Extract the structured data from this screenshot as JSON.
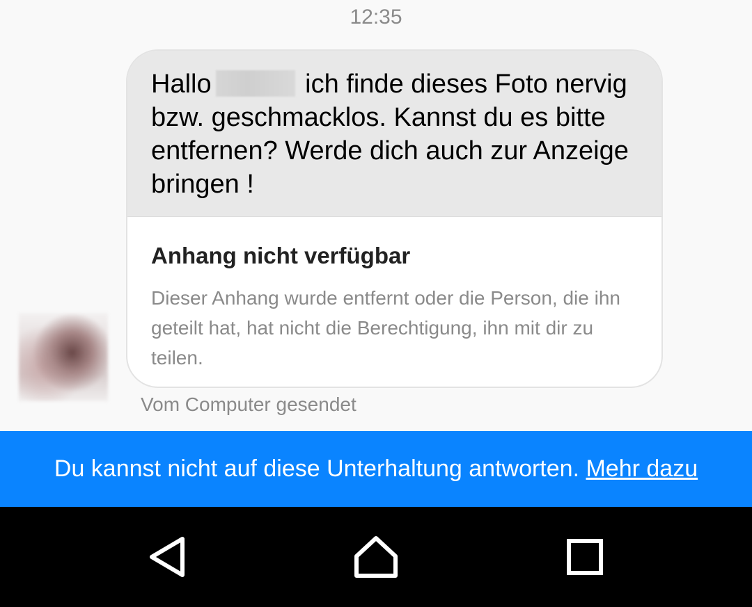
{
  "conversation": {
    "timestamp": "12:35",
    "message": {
      "greeting": "Hallo",
      "text_after_name": " ich finde dieses Foto nervig bzw. geschmacklos. Kannst du es bitte entfernen? Werde dich auch zur Anzeige bringen !"
    },
    "attachment": {
      "title": "Anhang nicht verfügbar",
      "description": "Dieser Anhang wurde entfernt oder die Person, die ihn geteilt hat, hat nicht die Berechtigung, ihn mit dir zu teilen."
    },
    "sent_via": "Vom Computer gesendet"
  },
  "banner": {
    "text": "Du kannst nicht auf diese Unterhaltung antworten. ",
    "link": "Mehr dazu",
    "color": "#0a84ff"
  },
  "navbar": {
    "back_icon": "back-triangle-icon",
    "home_icon": "home-icon",
    "recents_icon": "recents-square-icon"
  }
}
